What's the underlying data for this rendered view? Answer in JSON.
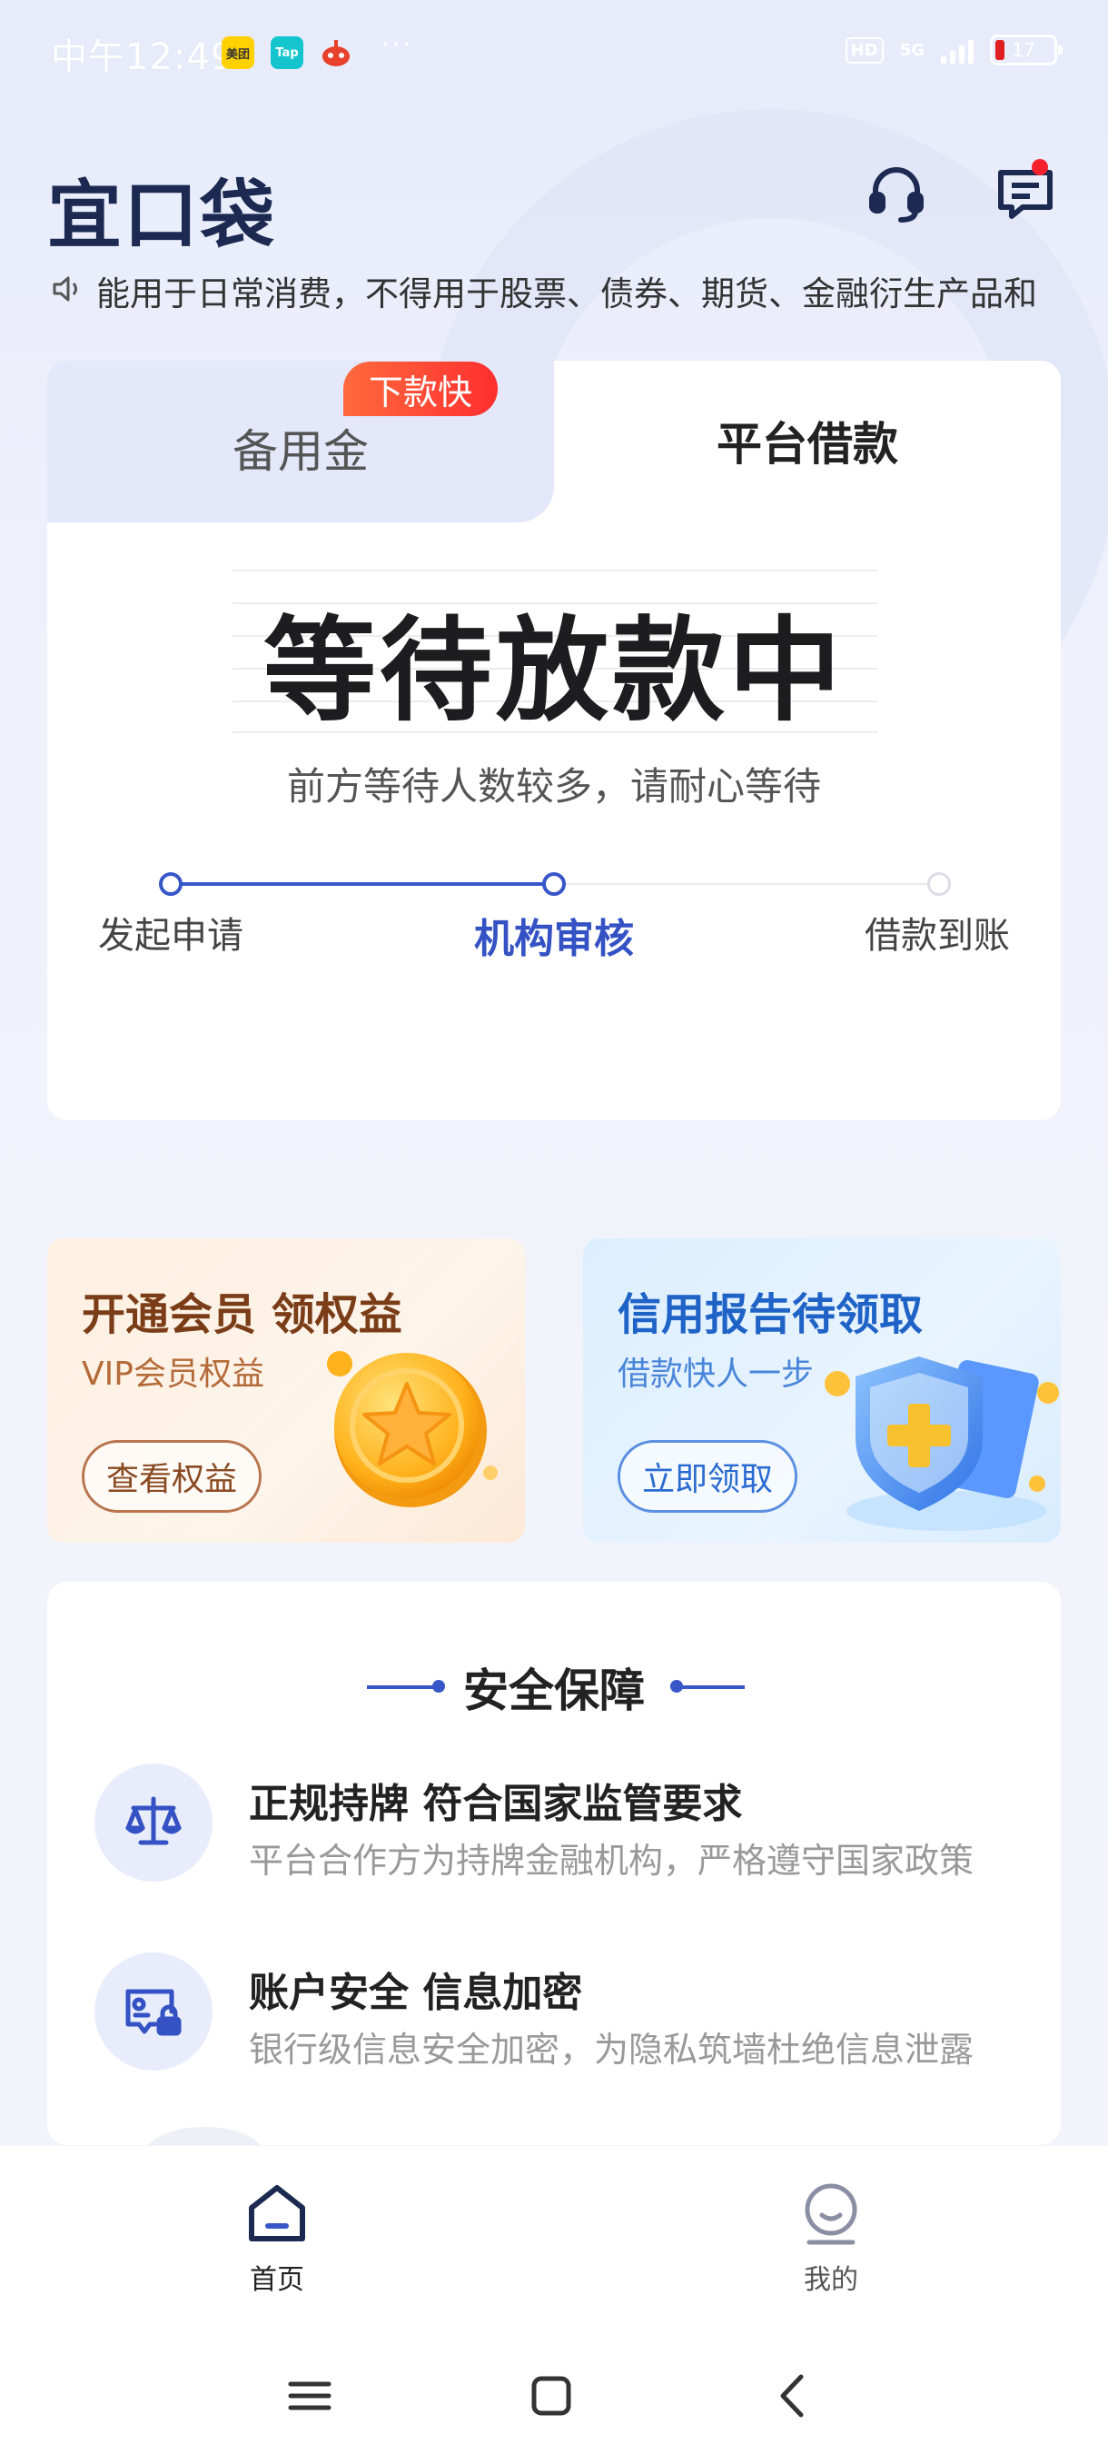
{
  "status_bar": {
    "time": "中午12:49",
    "apps": [
      "美团",
      "Tap",
      "game-app-icon"
    ],
    "more": "···",
    "hd": "HD",
    "network": "5G",
    "battery": "17"
  },
  "header": {
    "logo": "宜口袋",
    "support_icon": "headset-icon",
    "message_icon": "message-icon"
  },
  "notice": {
    "icon": "speaker-icon",
    "text": "能用于日常消费，不得用于股票、债券、期货、金融衍生产品和"
  },
  "loan_card": {
    "tabs": [
      {
        "label": "备用金",
        "active": false,
        "tag": "下款快"
      },
      {
        "label": "平台借款",
        "active": true
      }
    ],
    "status_title": "等待放款中",
    "status_subtitle": "前方等待人数较多，请耐心等待",
    "steps": [
      {
        "label": "发起申请",
        "state": "done"
      },
      {
        "label": "机构审核",
        "state": "current"
      },
      {
        "label": "借款到账",
        "state": "pending"
      }
    ]
  },
  "promos": [
    {
      "title": "开通会员 领权益",
      "subtitle": "VIP会员权益",
      "button": "查看权益",
      "icon": "star-coin-icon"
    },
    {
      "title": "信用报告待领取",
      "subtitle": "借款快人一步",
      "button": "立即领取",
      "icon": "shield-icon"
    }
  ],
  "security": {
    "title": "安全保障",
    "items": [
      {
        "title": "正规持牌 符合国家监管要求",
        "desc": "平台合作方为持牌金融机构，严格遵守国家政策",
        "icon": "scale-icon"
      },
      {
        "title": "账户安全 信息加密",
        "desc": "银行级信息安全加密，为隐私筑墙杜绝信息泄露",
        "icon": "secure-card-icon"
      }
    ]
  },
  "bottom_nav": [
    {
      "label": "首页",
      "icon": "home-icon",
      "active": true
    },
    {
      "label": "我的",
      "icon": "profile-icon",
      "active": false
    }
  ],
  "colors": {
    "primary": "#3757c9",
    "tag": "#ff3b30",
    "page_bg": "#eef1fb"
  }
}
